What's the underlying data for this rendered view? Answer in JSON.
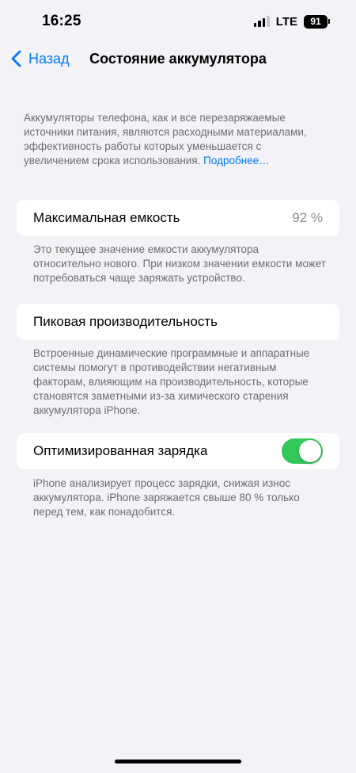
{
  "status_bar": {
    "time": "16:25",
    "network": "LTE",
    "battery_level": "91",
    "signal_bars_active": 3,
    "signal_bars_total": 4,
    "icons": [
      "signal-icon",
      "battery-icon"
    ]
  },
  "nav": {
    "back_label": "Назад",
    "title": "Состояние аккумулятора",
    "back_icon": "chevron-left-icon"
  },
  "intro": {
    "text": "Аккумуляторы телефона, как и все перезаряжаемые источники питания, являются расходными материалами, эффективность работы которых уменьшается с увеличением срока использования. ",
    "link": "Подробнее…"
  },
  "max_capacity": {
    "label": "Максимальная емкость",
    "value": "92 %",
    "footnote": "Это текущее значение емкости аккумулятора относительно нового. При низком значении емкости может потребоваться чаще заряжать устройство."
  },
  "peak_performance": {
    "label": "Пиковая производительность",
    "footnote": "Встроенные динамические программные и аппаратные системы помогут в противодействии негативным факторам, влияющим на производительность, которые становятся заметными из-за химического старения аккумулятора iPhone."
  },
  "optimized_charging": {
    "label": "Оптимизированная зарядка",
    "enabled": true,
    "footnote": "iPhone анализирует процесс зарядки, снижая износ аккумулятора. iPhone заряжается свыше 80 % только перед тем, как понадобится."
  },
  "colors": {
    "accent": "#007aff",
    "toggle_on": "#34c759",
    "background": "#f2f2f7",
    "secondary_text": "#6d6d72"
  }
}
